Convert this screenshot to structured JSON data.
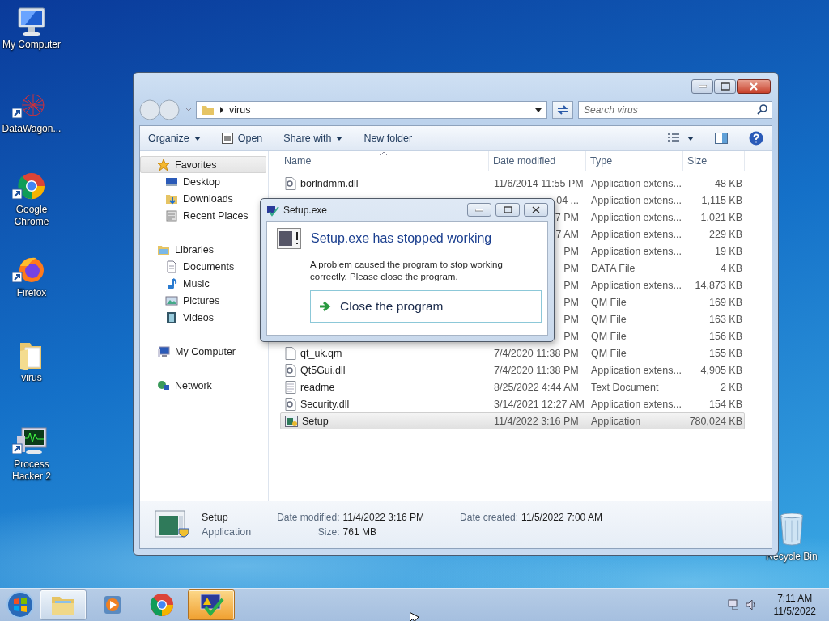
{
  "desktop_icons": [
    {
      "label": "My Computer",
      "kind": "computer",
      "shortcut": false
    },
    {
      "label": "DataWagon...",
      "kind": "network-art",
      "shortcut": true
    },
    {
      "label": "Google Chrome",
      "kind": "chrome",
      "shortcut": true
    },
    {
      "label": "Firefox",
      "kind": "firefox",
      "shortcut": true
    },
    {
      "label": "virus",
      "kind": "folder",
      "shortcut": false
    },
    {
      "label": "Process Hacker 2",
      "kind": "monitor",
      "shortcut": true
    }
  ],
  "recycle_bin": {
    "label": "Recycle Bin"
  },
  "explorer": {
    "address": "virus",
    "search": {
      "placeholder": "Search virus"
    },
    "toolbar": [
      {
        "label": "Organize",
        "kind": "menu"
      },
      {
        "label": "Open",
        "kind": "icon"
      },
      {
        "label": "Share with",
        "kind": "menu"
      },
      {
        "label": "New folder",
        "kind": "plain"
      }
    ],
    "nav": [
      {
        "label": "Favorites",
        "selected": true,
        "children": [
          {
            "label": "Desktop",
            "selected": false
          },
          {
            "label": "Downloads",
            "selected": false
          },
          {
            "label": "Recent Places",
            "selected": false
          }
        ]
      },
      {
        "label": "Libraries",
        "selected": false,
        "children": [
          {
            "label": "Documents",
            "selected": false
          },
          {
            "label": "Music",
            "selected": false
          },
          {
            "label": "Pictures",
            "selected": false
          },
          {
            "label": "Videos",
            "selected": false
          }
        ]
      },
      {
        "label": "My Computer",
        "selected": false
      },
      {
        "label": "Network",
        "selected": false
      }
    ],
    "columns": [
      "Name",
      "Date modified",
      "Type",
      "Size"
    ],
    "rows": [
      {
        "name": "borlndmm.dll",
        "kind": "dll",
        "date": "11/6/2014 11:55 PM",
        "type": "Application extens...",
        "size": "48 KB",
        "selected": false
      },
      {
        "date": "04 ...",
        "type": "Application extens...",
        "size": "1,115 KB",
        "selected": false
      },
      {
        "date": "7 PM",
        "type": "Application extens...",
        "size": "1,021 KB",
        "selected": false
      },
      {
        "date": "7 AM",
        "type": "Application extens...",
        "size": "229 KB",
        "selected": false
      },
      {
        "date": "PM",
        "type": "Application extens...",
        "size": "19 KB",
        "selected": false
      },
      {
        "date": "PM",
        "type": "DATA File",
        "size": "4 KB",
        "selected": false
      },
      {
        "date": "PM",
        "type": "Application extens...",
        "size": "14,873 KB",
        "selected": false
      },
      {
        "date": "PM",
        "type": "QM File",
        "size": "169 KB",
        "selected": false
      },
      {
        "date": "PM",
        "type": "QM File",
        "size": "163 KB",
        "selected": false
      },
      {
        "date": "PM",
        "type": "QM File",
        "size": "156 KB",
        "selected": false
      },
      {
        "name": "qt_uk.qm",
        "kind": "blank",
        "date": "7/4/2020 11:38 PM",
        "type": "QM File",
        "size": "155 KB",
        "selected": false
      },
      {
        "name": "Qt5Gui.dll",
        "kind": "dll",
        "date": "7/4/2020 11:38 PM",
        "type": "Application extens...",
        "size": "4,905 KB",
        "selected": false
      },
      {
        "name": "readme",
        "kind": "text",
        "date": "8/25/2022 4:44 AM",
        "type": "Text Document",
        "size": "2 KB",
        "selected": false
      },
      {
        "name": "Security.dll",
        "kind": "dll",
        "date": "3/14/2021 12:27 AM",
        "type": "Application extens...",
        "size": "154 KB",
        "selected": false
      },
      {
        "name": "Setup",
        "kind": "app",
        "date": "11/4/2022 3:16 PM",
        "type": "Application",
        "size": "780,024 KB",
        "selected": true
      }
    ],
    "details": {
      "name": "Setup",
      "type": "Application",
      "fields": [
        {
          "label": "Date modified:",
          "value": "11/4/2022 3:16 PM"
        },
        {
          "label": "Size:",
          "value": "761 MB"
        },
        {
          "label": "Date created:",
          "value": "11/5/2022 7:00 AM"
        }
      ]
    }
  },
  "dialog": {
    "title": "Setup.exe",
    "heading": "Setup.exe has stopped working",
    "message": "A problem caused the program to stop working correctly. Please close the program.",
    "action": "Close the program"
  },
  "taskbar": {
    "apps": [
      {
        "kind": "explorer",
        "running": true,
        "selected": false
      },
      {
        "kind": "media",
        "running": false,
        "selected": false
      },
      {
        "kind": "chrome",
        "running": false,
        "selected": false
      },
      {
        "kind": "setup",
        "running": true,
        "selected": true
      }
    ],
    "time": "7:11 AM",
    "date": "11/5/2022"
  }
}
